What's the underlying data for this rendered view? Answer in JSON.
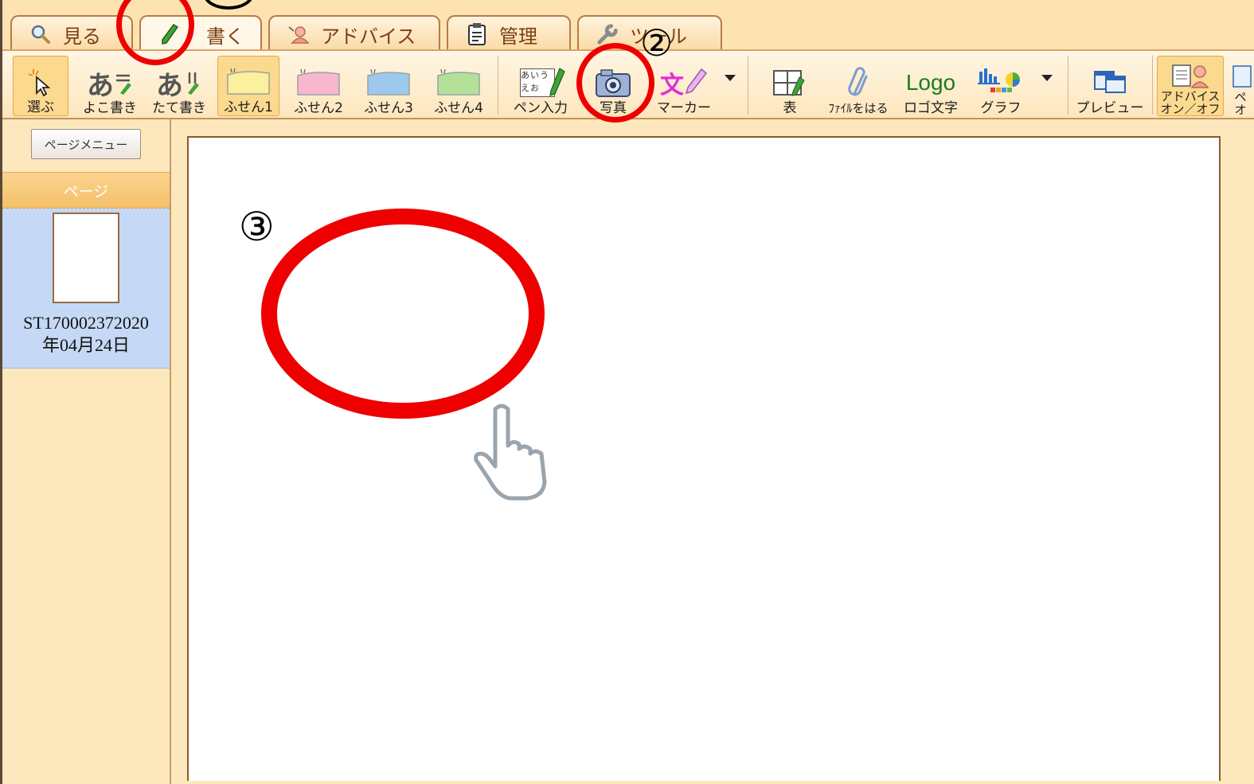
{
  "tabs": [
    {
      "label": "見る",
      "icon": "magnifier-icon"
    },
    {
      "label": "書く",
      "icon": "pencil-icon"
    },
    {
      "label": "アドバイス",
      "icon": "advisor-icon"
    },
    {
      "label": "管理",
      "icon": "clipboard-icon"
    },
    {
      "label": "ツール",
      "icon": "wrench-icon"
    }
  ],
  "toolbar": {
    "select": "選ぶ",
    "horizontal_text": "よこ書き",
    "vertical_text": "たて書き",
    "horizontal_glyph": "あ",
    "vertical_glyph": "あ",
    "sticky1": "ふせん1",
    "sticky2": "ふせん2",
    "sticky3": "ふせん3",
    "sticky4": "ふせん4",
    "pen_input": "ペン入力",
    "pen_glyph": "あいうえお",
    "photo": "写真",
    "marker": "マーカー",
    "marker_glyph": "文",
    "table": "表",
    "attach_file": "ﾌｧｲﾙをはる",
    "logo_text": "ロゴ文字",
    "logo_glyph": "Logo",
    "graph": "グラフ",
    "preview": "プレビュー",
    "advice_toggle_line1": "アドバイス",
    "advice_toggle_line2": "オン／オフ",
    "page_toggle_line1": "ペ",
    "page_toggle_line2": "オ"
  },
  "sidebar": {
    "page_menu": "ページメニュー",
    "page_header": "ページ",
    "page_label_line1": "ST170002372020",
    "page_label_line2": "年04月24日"
  },
  "annotations": {
    "step2": "②",
    "step3": "③",
    "ring_color": "#ee0000"
  },
  "colors": {
    "background": "#fde8bd",
    "tab_text": "#7a3e12",
    "selected_page": "#c5d9f6",
    "page_header": "#f3c06a"
  }
}
